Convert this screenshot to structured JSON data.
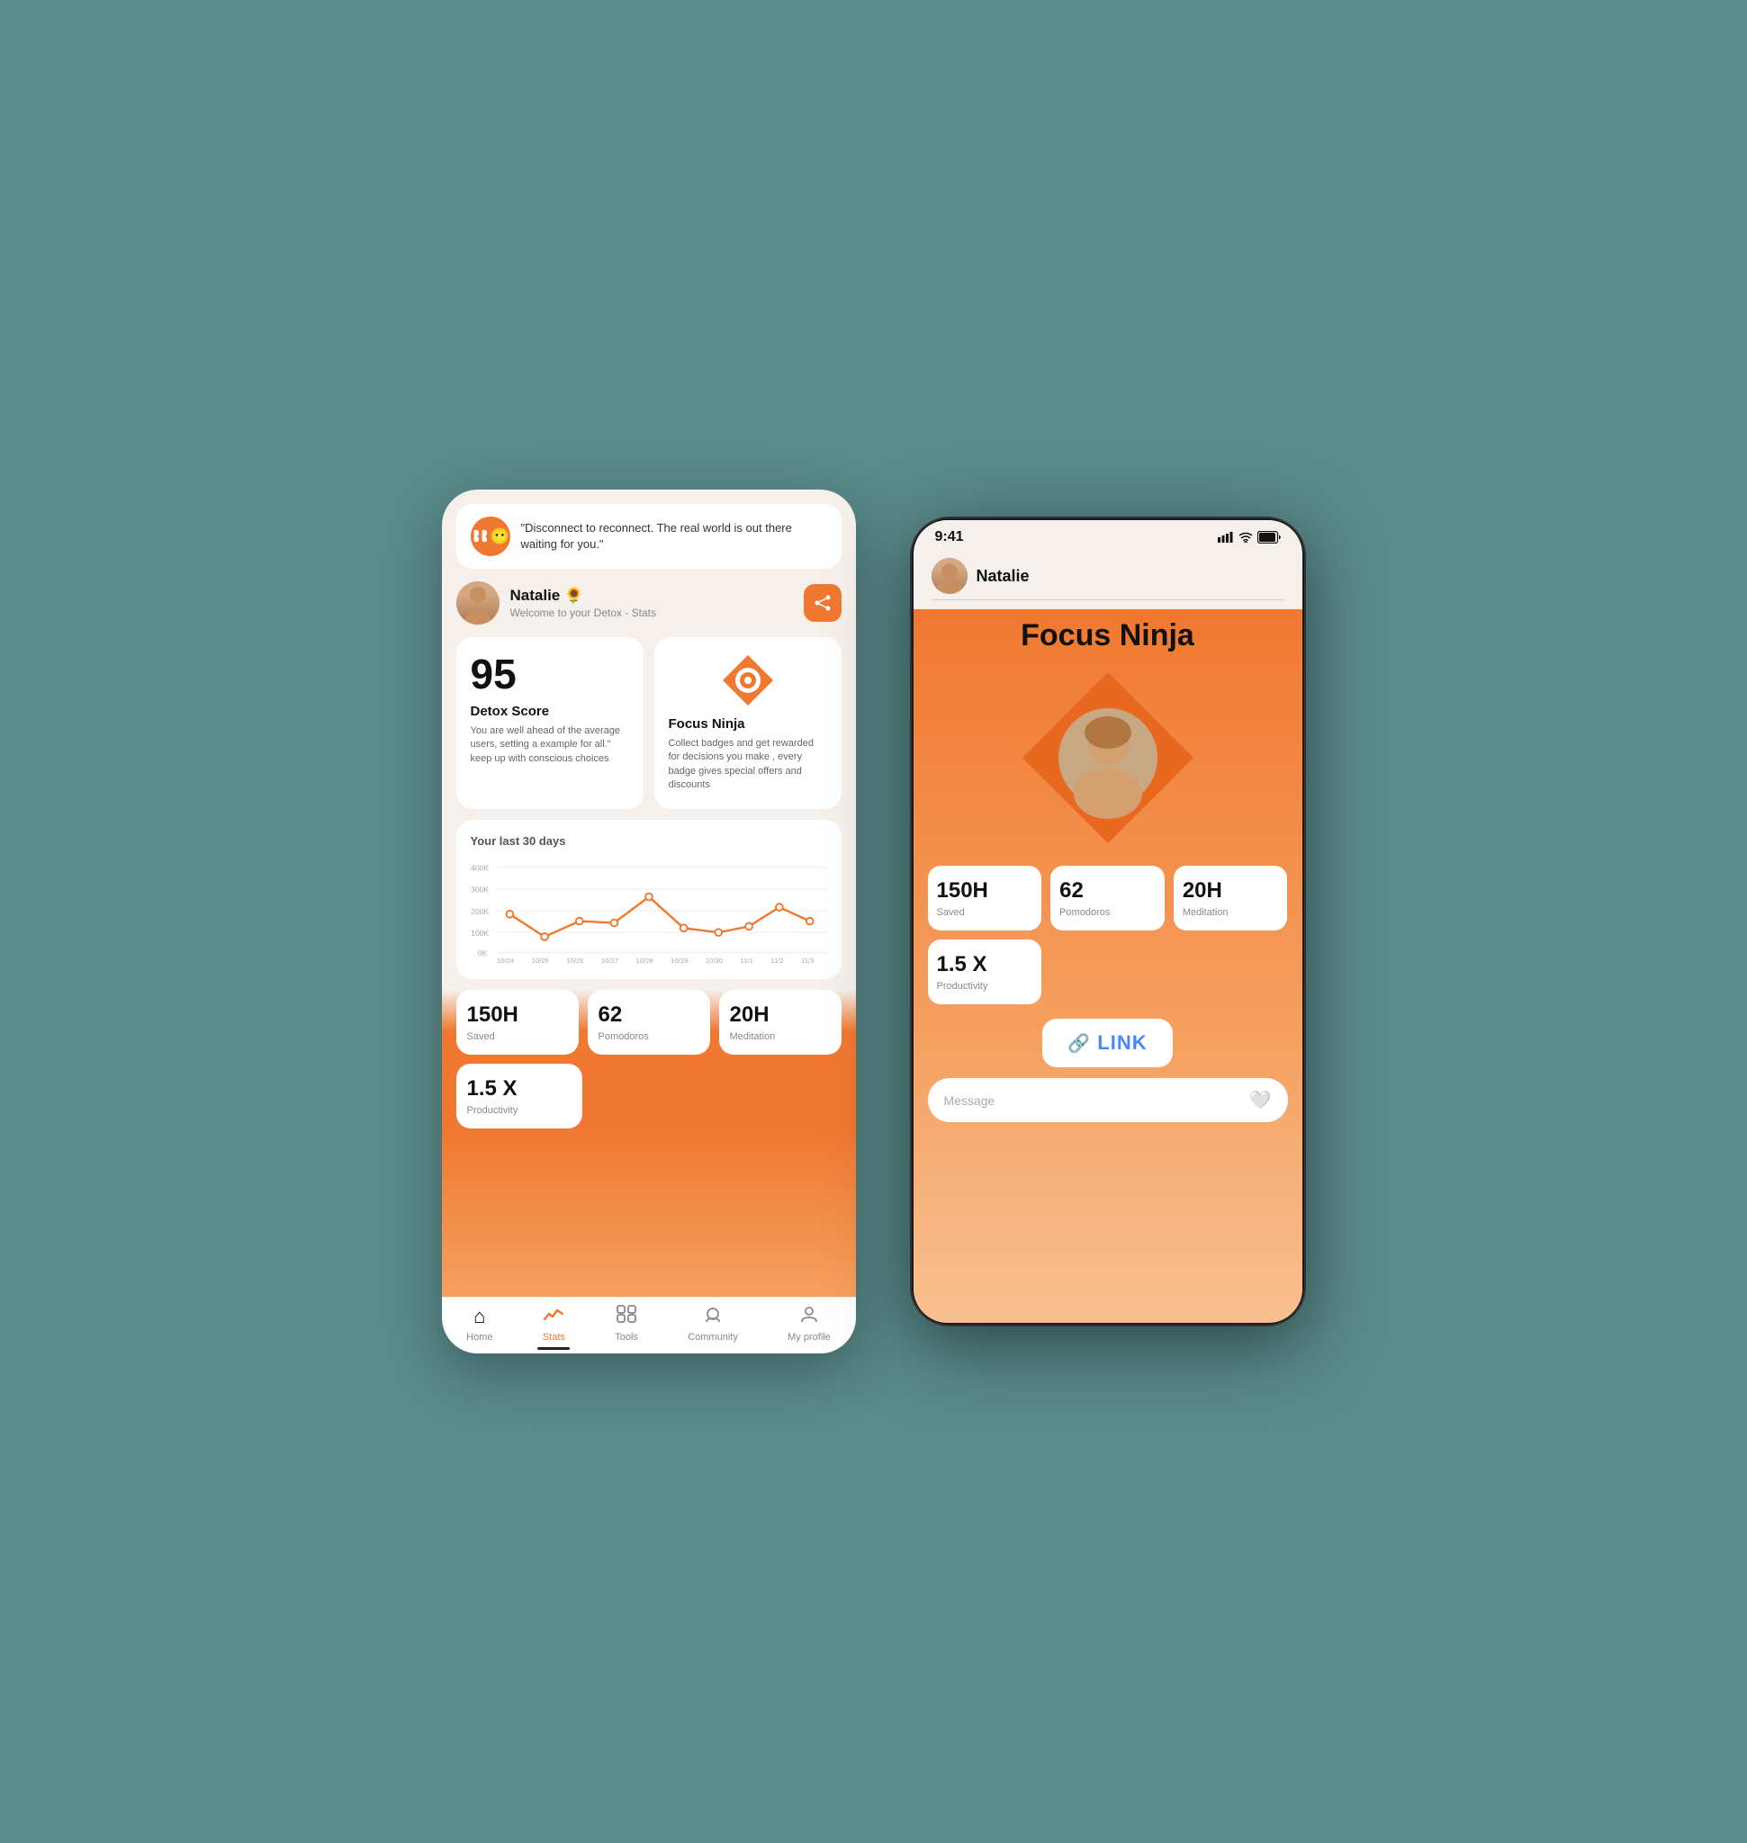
{
  "left_phone": {
    "quote": "\"Disconnect to reconnect. The real world is out there waiting for you.\"",
    "profile": {
      "name": "Natalie 🌻",
      "subtitle": "Welcome to your Detox - Stats"
    },
    "detox_score": {
      "number": "95",
      "title": "Detox Score",
      "description": "You are well ahead of the average users, setting a example for all.\" keep up with conscious choices"
    },
    "focus_ninja": {
      "title": "Focus Ninja",
      "description": "Collect badges and get rewarded for decisions you make , every badge gives special offers and discounts"
    },
    "chart": {
      "title": "Your last 30 days",
      "y_labels": [
        "400K",
        "300K",
        "200K",
        "100K",
        "0K"
      ],
      "x_labels": [
        "10/24",
        "10/25",
        "10/26",
        "10/27",
        "10/28",
        "10/29",
        "10/30",
        "11/1",
        "11/2",
        "11/3"
      ]
    },
    "metrics": [
      {
        "value": "150H",
        "label": "Saved"
      },
      {
        "value": "62",
        "label": "Pomodoros"
      },
      {
        "value": "20H",
        "label": "Meditation"
      }
    ],
    "productivity": {
      "value": "1.5 X",
      "label": "Productivity"
    },
    "nav": [
      {
        "icon": "⌂",
        "label": "Home",
        "active": false
      },
      {
        "icon": "↗",
        "label": "Stats",
        "active": true
      },
      {
        "icon": "⊞",
        "label": "Tools",
        "active": false
      },
      {
        "icon": "⊕",
        "label": "Community",
        "active": false
      },
      {
        "icon": "👤",
        "label": "My profile",
        "active": false
      }
    ]
  },
  "right_phone": {
    "status_time": "9:41",
    "profile_name": "Natalie",
    "focus_ninja_title": "Focus Ninja",
    "stats": [
      {
        "value": "150H",
        "label": "Saved"
      },
      {
        "value": "62",
        "label": "Pomodoros"
      },
      {
        "value": "20H",
        "label": "Meditation"
      },
      {
        "value": "1.5 X",
        "label": "Productivity"
      }
    ],
    "link_label": "LINK",
    "message_placeholder": "Message"
  },
  "colors": {
    "orange": "#f07830",
    "orange_light": "#f5a060",
    "blue": "#4488ff",
    "background": "#5a8a8a"
  }
}
